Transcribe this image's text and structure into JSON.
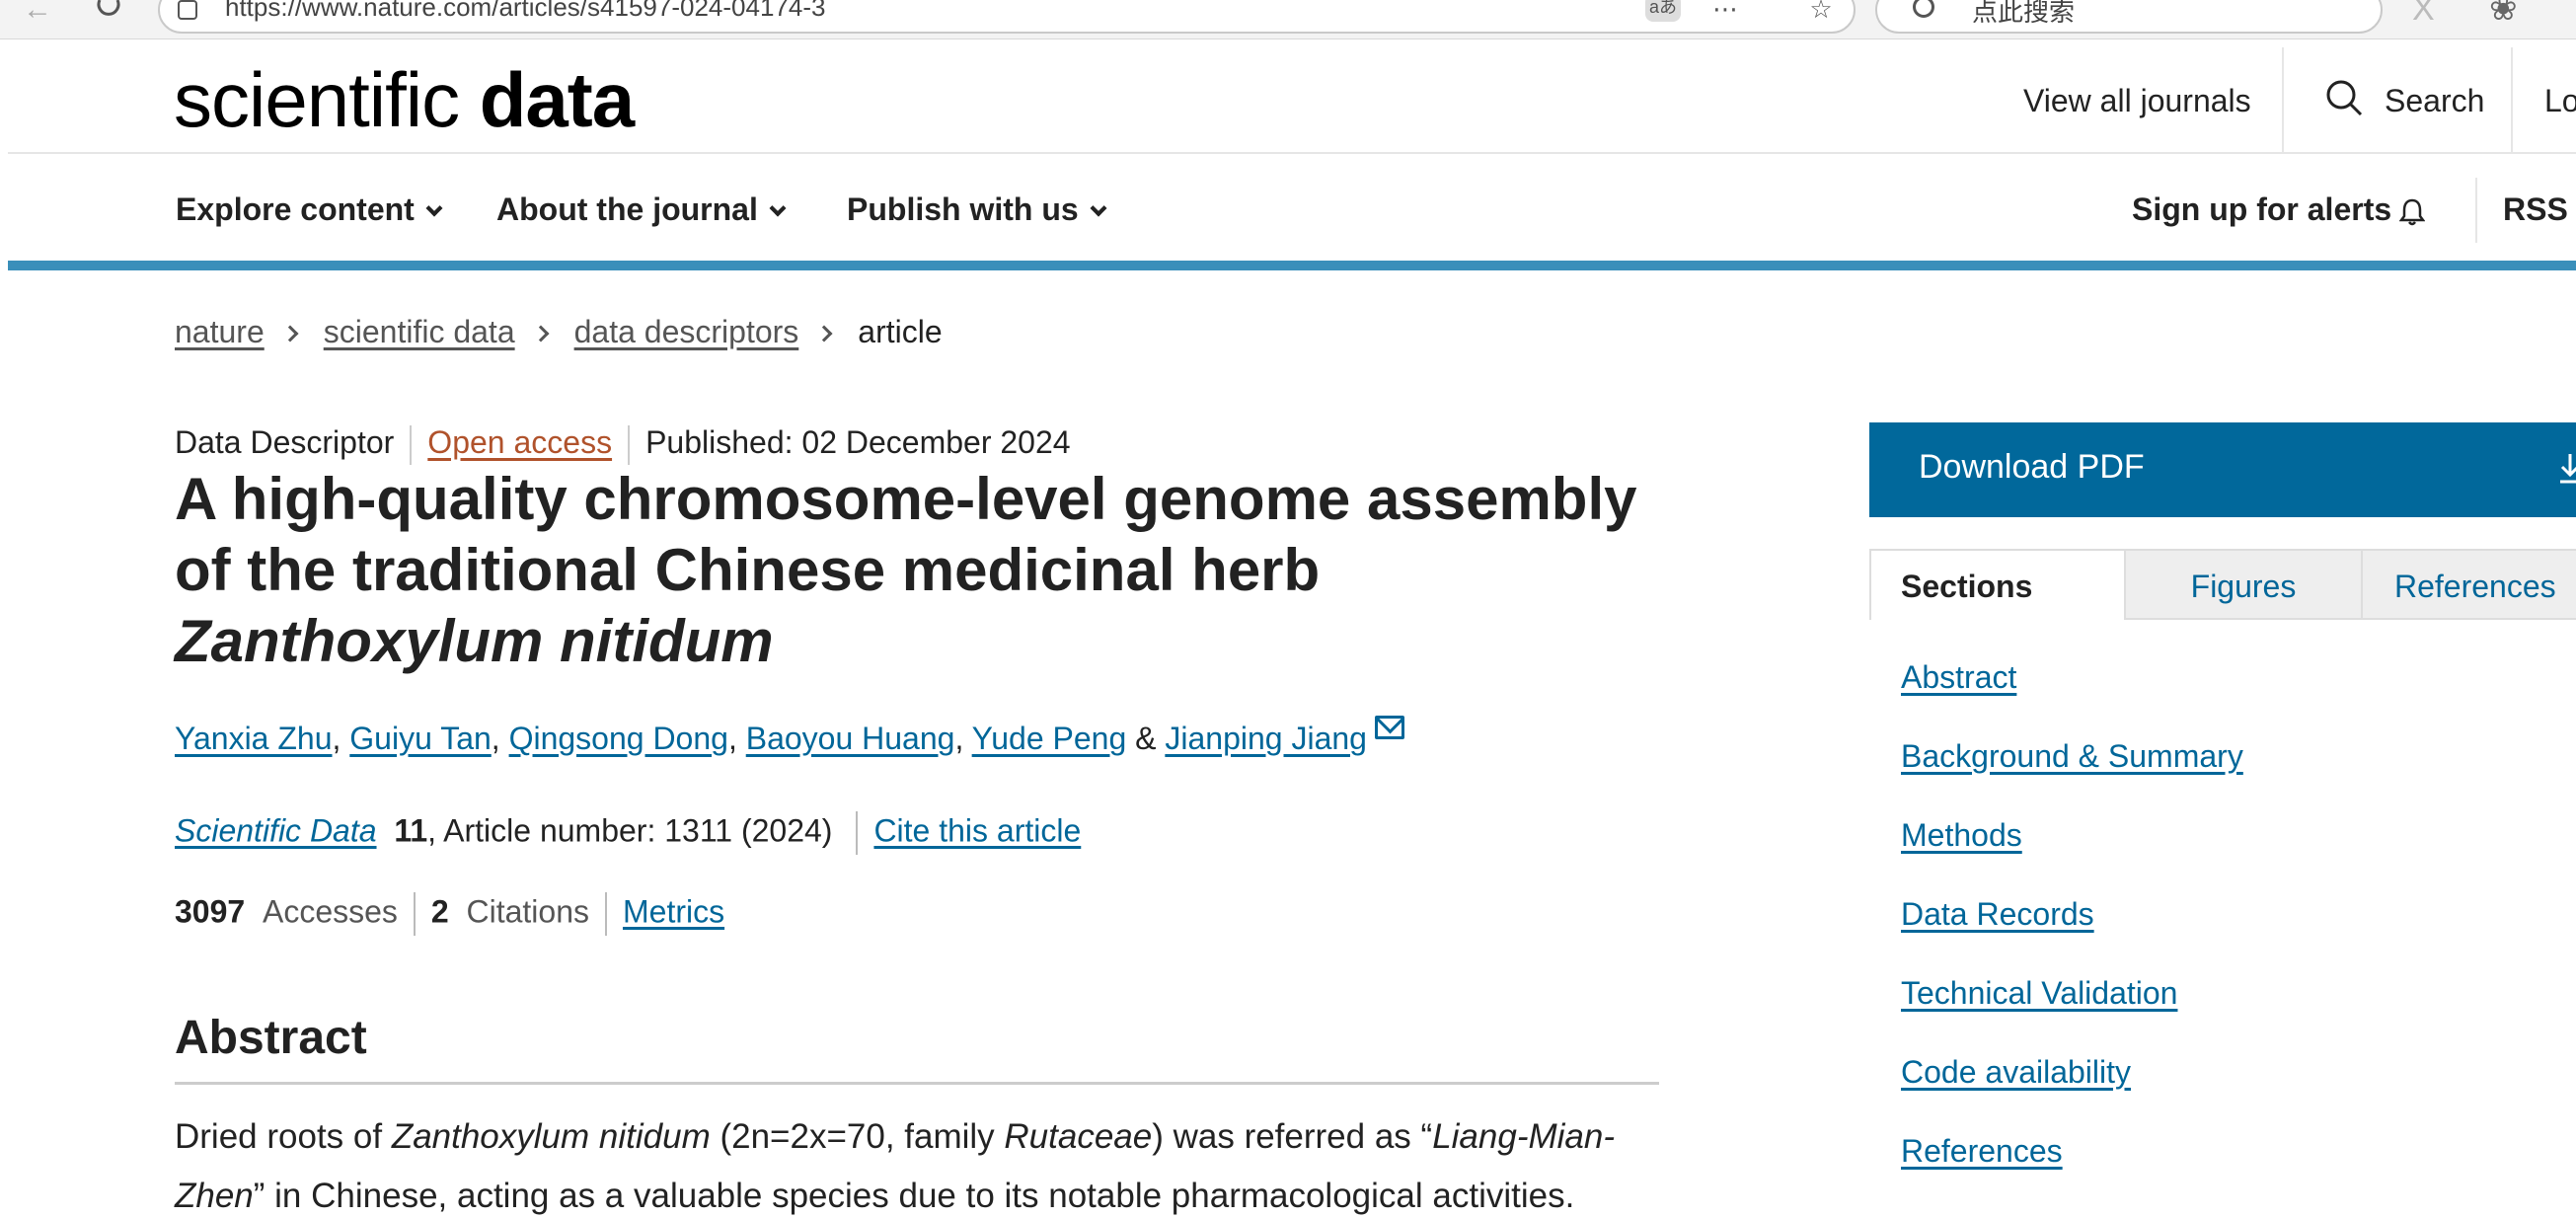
{
  "browser": {
    "url": "https://www.nature.com/articles/s41597-024-04174-3",
    "search_placeholder": "点此搜索",
    "translate_label": "aあ"
  },
  "header": {
    "logo_light": "scientific ",
    "logo_bold": "data",
    "view_all_journals": "View all journals",
    "search_label": "Search",
    "login_label": "Lo"
  },
  "nav": {
    "items": [
      {
        "label": "Explore content"
      },
      {
        "label": "About the journal"
      },
      {
        "label": "Publish with us"
      }
    ],
    "alerts_label": "Sign up for alerts",
    "rss_label": "RSS f"
  },
  "breadcrumb": {
    "items": [
      "nature",
      "scientific data",
      "data descriptors"
    ],
    "current": "article"
  },
  "article": {
    "type": "Data Descriptor",
    "access": "Open access",
    "published": "Published: 02 December 2024",
    "title_plain": "A high-quality chromosome-level genome assembly of the traditional Chinese medicinal herb ",
    "title_italic": "Zanthoxylum nitidum",
    "authors": [
      "Yanxia Zhu",
      "Guiyu Tan",
      "Qingsong Dong",
      "Baoyou Huang",
      "Yude Peng",
      "Jianping Jiang"
    ],
    "comma": ",",
    "and": "&",
    "journal": "Scientific Data",
    "volume": "11",
    "article_number": ", Article number: 1311 (2024)",
    "cite_label": "Cite this article",
    "accesses_count": "3097",
    "accesses_label": "Accesses",
    "citations_count": "2",
    "citations_label": "Citations",
    "metrics_label": "Metrics",
    "abstract_heading": "Abstract",
    "abstract": {
      "p1": "Dried roots of ",
      "i1": "Zanthoxylum nitidum",
      "p2": " (2n=2x=70, family ",
      "i2": "Rutaceae",
      "p3": ") was referred as “",
      "i3": "Liang-Mian-Zhen",
      "p4": "” in Chinese, acting as a valuable species due to its notable pharmacological activities."
    }
  },
  "sidebar": {
    "download_label": "Download PDF",
    "tabs": [
      {
        "label": "Sections"
      },
      {
        "label": "Figures"
      },
      {
        "label": "References"
      }
    ],
    "toc": [
      "Abstract",
      "Background & Summary",
      "Methods",
      "Data Records",
      "Technical Validation",
      "Code availability",
      "References"
    ]
  },
  "colors": {
    "link": "#006699",
    "accent_bar": "#3a8fba",
    "download_bg": "#01689b",
    "open_access": "#b0522b"
  }
}
